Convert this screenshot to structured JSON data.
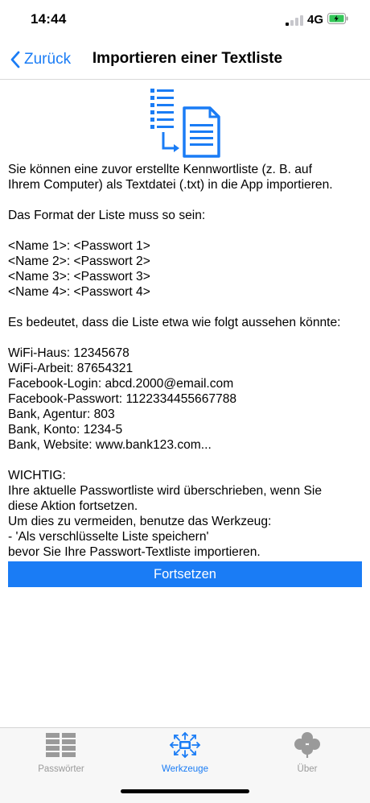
{
  "status": {
    "time": "14:44",
    "network": "4G"
  },
  "nav": {
    "back_label": "Zurück",
    "title": "Importieren einer Textliste"
  },
  "body": {
    "intro": [
      "Sie können eine zuvor erstellte Kennwortliste (z. B. auf",
      "Ihrem Computer) als Textdatei (.txt) in die App importieren."
    ],
    "format_heading": "Das Format der Liste muss so sein:",
    "format_lines": [
      "<Name 1>: <Passwort 1>",
      "<Name 2>: <Passwort 2>",
      "<Name 3>: <Passwort 3>",
      "<Name 4>: <Passwort 4>"
    ],
    "example_heading": "Es bedeutet, dass die Liste etwa wie folgt aussehen könnte:",
    "example_lines": [
      "WiFi-Haus: 12345678",
      "WiFi-Arbeit: 87654321",
      "Facebook-Login: abcd.2000@email.com",
      "Facebook-Passwort: 1122334455667788",
      "Bank, Agentur: 803",
      "Bank, Konto: 1234-5",
      "Bank, Website: www.bank123.com..."
    ],
    "warning_lines": [
      "WICHTIG:",
      "Ihre aktuelle Passwortliste wird überschrieben, wenn Sie",
      "diese Aktion fortsetzen.",
      "Um dies zu vermeiden, benutze das Werkzeug:",
      "- 'Als verschlüsselte Liste speichern'",
      "bevor Sie Ihre Passwort-Textliste importieren."
    ]
  },
  "continue_button": {
    "label": "Fortsetzen"
  },
  "tabs": [
    {
      "label": "Passwörter",
      "icon": "list-icon",
      "active": false
    },
    {
      "label": "Werkzeuge",
      "icon": "tools-icon",
      "active": true
    },
    {
      "label": "Über",
      "icon": "clover-icon",
      "active": false
    }
  ],
  "colors": {
    "accent": "#1a7cf5",
    "inactive": "#9a9a9a",
    "battery": "#34c759"
  }
}
